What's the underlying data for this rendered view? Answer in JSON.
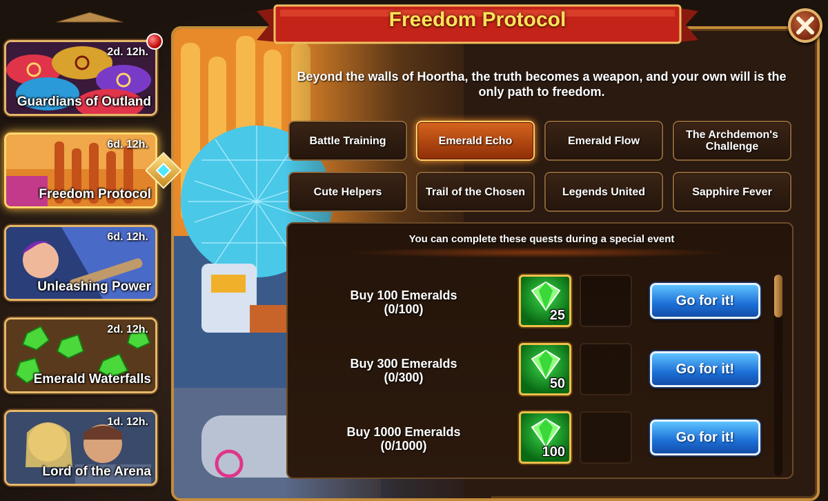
{
  "title": "Freedom Protocol",
  "description": "Beyond the walls of Hoortha, the truth becomes a weapon, and your own will is the only path to freedom.",
  "sidebar": {
    "events": [
      {
        "title": "Guardians of Outland",
        "time": "2d. 12h."
      },
      {
        "title": "Freedom Protocol",
        "time": "6d. 12h."
      },
      {
        "title": "Unleashing Power",
        "time": "6d. 12h."
      },
      {
        "title": "Emerald Waterfalls",
        "time": "2d. 12h."
      },
      {
        "title": "Lord of the Arena",
        "time": "1d. 12h."
      }
    ]
  },
  "tabs": [
    {
      "label": "Battle Training"
    },
    {
      "label": "Emerald Echo"
    },
    {
      "label": "Emerald Flow"
    },
    {
      "label": "The Archdemon's Challenge"
    },
    {
      "label": "Cute Helpers"
    },
    {
      "label": "Trail of the Chosen"
    },
    {
      "label": "Legends United"
    },
    {
      "label": "Sapphire Fever"
    }
  ],
  "active_tab": "Emerald Echo",
  "quest_header": "You can complete these quests during a special event",
  "quests": [
    {
      "name": "Buy 100 Emeralds",
      "progress": "(0/100)",
      "reward_count": "25",
      "button": "Go for it!"
    },
    {
      "name": "Buy 300 Emeralds",
      "progress": "(0/300)",
      "reward_count": "50",
      "button": "Go for it!"
    },
    {
      "name": "Buy 1000 Emeralds",
      "progress": "(0/1000)",
      "reward_count": "100",
      "button": "Go for it!"
    }
  ],
  "colors": {
    "title_text": "#ffe35a",
    "active_tab": "#d6651e",
    "button_blue": "#1c6fd6",
    "reward_green": "#3bd84a"
  }
}
